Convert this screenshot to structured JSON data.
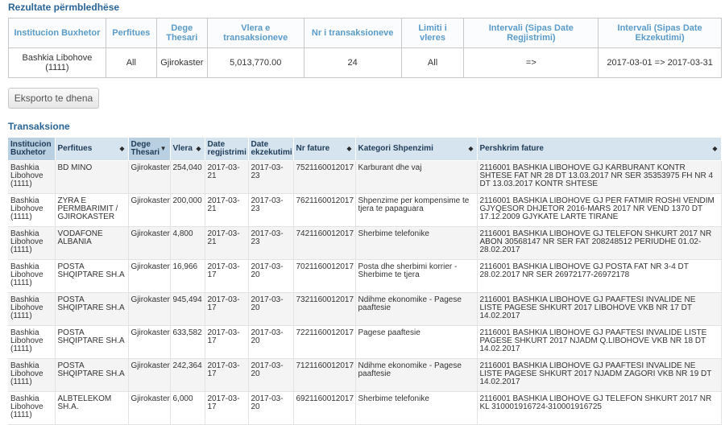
{
  "summary": {
    "title": "Rezultate përmbledhëse",
    "headers": [
      "Institucion Buxhetor",
      "Perfitues",
      "Dege Thesari",
      "Vlera e transaksioneve",
      "Nr i transaksioneve",
      "Limiti i vleres",
      "Intervali (Sipas Date Regjistrimi)",
      "Intervali (Sipas Date Ekzekutimi)"
    ],
    "row": [
      "Bashkia Libohove (1111)",
      "All",
      "Gjirokaster",
      "5,013,770.00",
      "24",
      "All",
      "=>",
      "2017-03-01 => 2017-03-31"
    ]
  },
  "export_label": "Eksporto te dhena",
  "transactions": {
    "title": "Transaksione",
    "headers": [
      "Institucion Buxhetor",
      "Perfitues",
      "Dege Thesari",
      "Vlera",
      "Date regjistrimi",
      "Date ekzekutimi",
      "Nr fature",
      "Kategori Shpenzimi",
      "Pershkrim fature"
    ],
    "rows": [
      [
        "Bashkia Libohove (1111)",
        "BD MINO",
        "Gjirokaster",
        "254,040",
        "2017-03-21",
        "2017-03-23",
        "7521160012017",
        "Karburant dhe vaj",
        "2116001 BASHKIA LIBOHOVE GJ KARBURANT KONTR SHTESE FAT NR 28 DT 13.03.2017 NR SER 35353975 FH NR 4 DT 13.03.2017 KONTR SHTESE"
      ],
      [
        "Bashkia Libohove (1111)",
        "ZYRA E PERMBARIMIT / GJIROKASTER",
        "Gjirokaster",
        "200,000",
        "2017-03-21",
        "2017-03-23",
        "7621160012017",
        "Shpenzime per kompensime te tjera te papaguara",
        "2116001 BASHKIA LIBOHOVE GJ PER FATMIR ROSHI VENDIM GJYQESOR DHJETOR 2016-MARS 2017 NR VEND 1370 DT 17.12.2009 GJYKATE LARTE TIRANE"
      ],
      [
        "Bashkia Libohove (1111)",
        "VODAFONE ALBANIA",
        "Gjirokaster",
        "4,800",
        "2017-03-21",
        "2017-03-23",
        "7421160012017",
        "Sherbime telefonike",
        "2116001 BASHKIA LIBOHOVE GJ TELEFON SHKURT 2017 NR ABON 30568147 NR SER FAT 208248512 PERIUDHE 01.02-28.02.2017"
      ],
      [
        "Bashkia Libohove (1111)",
        "POSTA SHQIPTARE SH.A",
        "Gjirokaster",
        "16,966",
        "2017-03-17",
        "2017-03-20",
        "7021160012017",
        "Posta dhe sherbimi korrier - Sherbime te tjera",
        "2116001 BASHKIA LIBOHOVE GJ POSTA FAT NR 3-4 DT 28.02.2017 NR SER 26972177-26972178"
      ],
      [
        "Bashkia Libohove (1111)",
        "POSTA SHQIPTARE SH.A",
        "Gjirokaster",
        "945,494",
        "2017-03-17",
        "2017-03-20",
        "7321160012017",
        "Ndihme ekonomike - Pagese paaftesie",
        "2116001 BASHKIA LIBOHOVE GJ PAAFTESI INVALIDE NE LISTE PAGESE SHKURT 2017 LIBOHOVE VKB NR 17 DT 14.02.2017"
      ],
      [
        "Bashkia Libohove (1111)",
        "POSTA SHQIPTARE SH.A",
        "Gjirokaster",
        "633,582",
        "2017-03-17",
        "2017-03-20",
        "7221160012017",
        "Pagese paaftesie",
        "2116001 BASHKIA LIBOHOVE GJ PAAFTESI INVALIDE LISTE PAGESE SHKURT 2017 NJADM Q.LIBOHOVE VKB NR 18 DT 14.02.2017"
      ],
      [
        "Bashkia Libohove (1111)",
        "POSTA SHQIPTARE SH.A",
        "Gjirokaster",
        "242,364",
        "2017-03-17",
        "2017-03-20",
        "7121160012017",
        "Ndihme ekonomike - Pagese paaftesie",
        "2116001 BASHKIA LIBOHOVE GJ PAAFTESI INVALIDE NE LISTE PAGESE SHKURT 2017 NJADM ZAGORI VKB NR 19 DT 14.02.2017"
      ],
      [
        "Bashkia Libohove (1111)",
        "ALBTELEKOM SH.A.",
        "Gjirokaster",
        "6,000",
        "2017-03-17",
        "2017-03-20",
        "6921160012017",
        "Sherbime telefonike",
        "2116001 BASHKIA LIBOHOVE GJ TELEFON SHKURT 2017 NR KL 310001916724-310001916725"
      ]
    ]
  },
  "icons": {
    "sort_both": "sort-both-icon",
    "sort_desc": "sort-desc-icon"
  }
}
